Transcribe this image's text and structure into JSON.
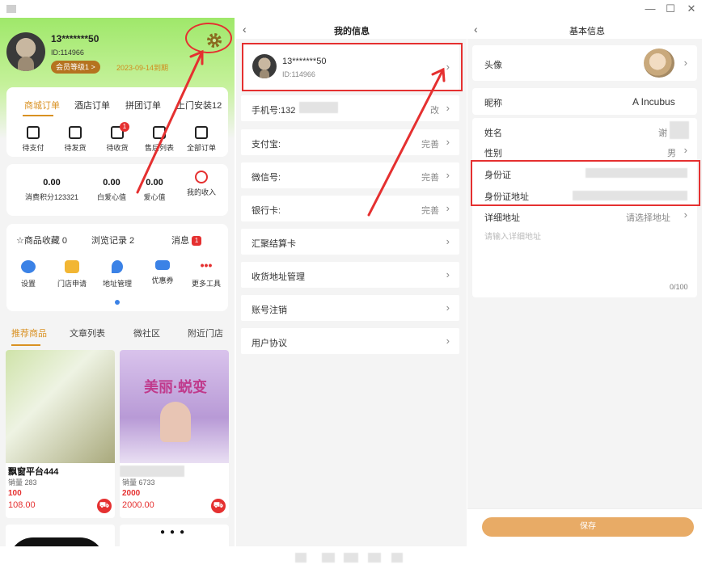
{
  "window": {
    "minimize": "—",
    "maximize": "☐",
    "close": "✕"
  },
  "left": {
    "user": {
      "name": "13*******50",
      "id": "ID:114966",
      "member_level": "会员等级1 >",
      "member_date": "2023-09-14到期"
    },
    "order_tabs": [
      "商城订单",
      "酒店订单",
      "拼团订单",
      "上门安装12"
    ],
    "order_icons": [
      {
        "label": "待支付",
        "icon": "wallet-icon"
      },
      {
        "label": "待发货",
        "icon": "package-icon"
      },
      {
        "label": "待收货",
        "icon": "truck-icon",
        "badge": "1"
      },
      {
        "label": "售后列表",
        "icon": "refund-icon"
      },
      {
        "label": "全部订单",
        "icon": "list-icon"
      }
    ],
    "stats": [
      {
        "value": "0.00",
        "label": "消费积分123321"
      },
      {
        "value": "0.00",
        "label": "白爱心值"
      },
      {
        "value": "0.00",
        "label": "爱心值"
      }
    ],
    "my_income": "我的收入",
    "quick": {
      "favorites": "☆商品收藏 0",
      "history": "浏览记录 2",
      "messages": "消息",
      "messages_badge": "1"
    },
    "tools": [
      {
        "label": "设置",
        "icon": "settings-icon",
        "color": "#3b82e6"
      },
      {
        "label": "门店申请",
        "icon": "store-icon",
        "color": "#f2b634"
      },
      {
        "label": "地址管理",
        "icon": "location-icon",
        "color": "#3b82e6"
      },
      {
        "label": "优惠券",
        "icon": "coupon-icon",
        "color": "#3b82e6"
      },
      {
        "label": "更多工具",
        "icon": "more-icon",
        "color": "#e53030"
      }
    ],
    "content_tabs": [
      "推荐商品",
      "文章列表",
      "微社区",
      "附近门店"
    ],
    "products": [
      {
        "name": "飘窗平台444",
        "sales": "销量 283",
        "price1": "100",
        "price2": "108.00"
      },
      {
        "name": "",
        "sales": "销量 6733",
        "price1": "2000",
        "price2": "2000.00",
        "poster_title": "美丽·蜕变"
      }
    ]
  },
  "middle": {
    "title": "我的信息",
    "profile": {
      "name": "13*******50",
      "id": "ID:114966"
    },
    "rows": [
      {
        "label": "手机号:132",
        "value": "改"
      },
      {
        "label": "支付宝:",
        "value": "完善"
      },
      {
        "label": "微信号:",
        "value": "完善"
      },
      {
        "label": "银行卡:",
        "value": "完善"
      },
      {
        "label": "汇聚结算卡",
        "value": ""
      },
      {
        "label": "收货地址管理",
        "value": ""
      },
      {
        "label": "账号注销",
        "value": ""
      },
      {
        "label": "用户协议",
        "value": ""
      }
    ]
  },
  "right": {
    "title": "基本信息",
    "avatar_label": "头像",
    "nickname_label": "昵称",
    "nickname_value": "A   Incubus",
    "name_label": "姓名",
    "name_value": "谢",
    "gender_label": "性别",
    "gender_value": "男",
    "id_card_label": "身份证",
    "id_address_label": "身份证地址",
    "detail_address_label": "详细地址",
    "detail_address_select": "请选择地址",
    "detail_placeholder": "请输入详细地址",
    "char_count": "0/100",
    "save": "保存"
  }
}
